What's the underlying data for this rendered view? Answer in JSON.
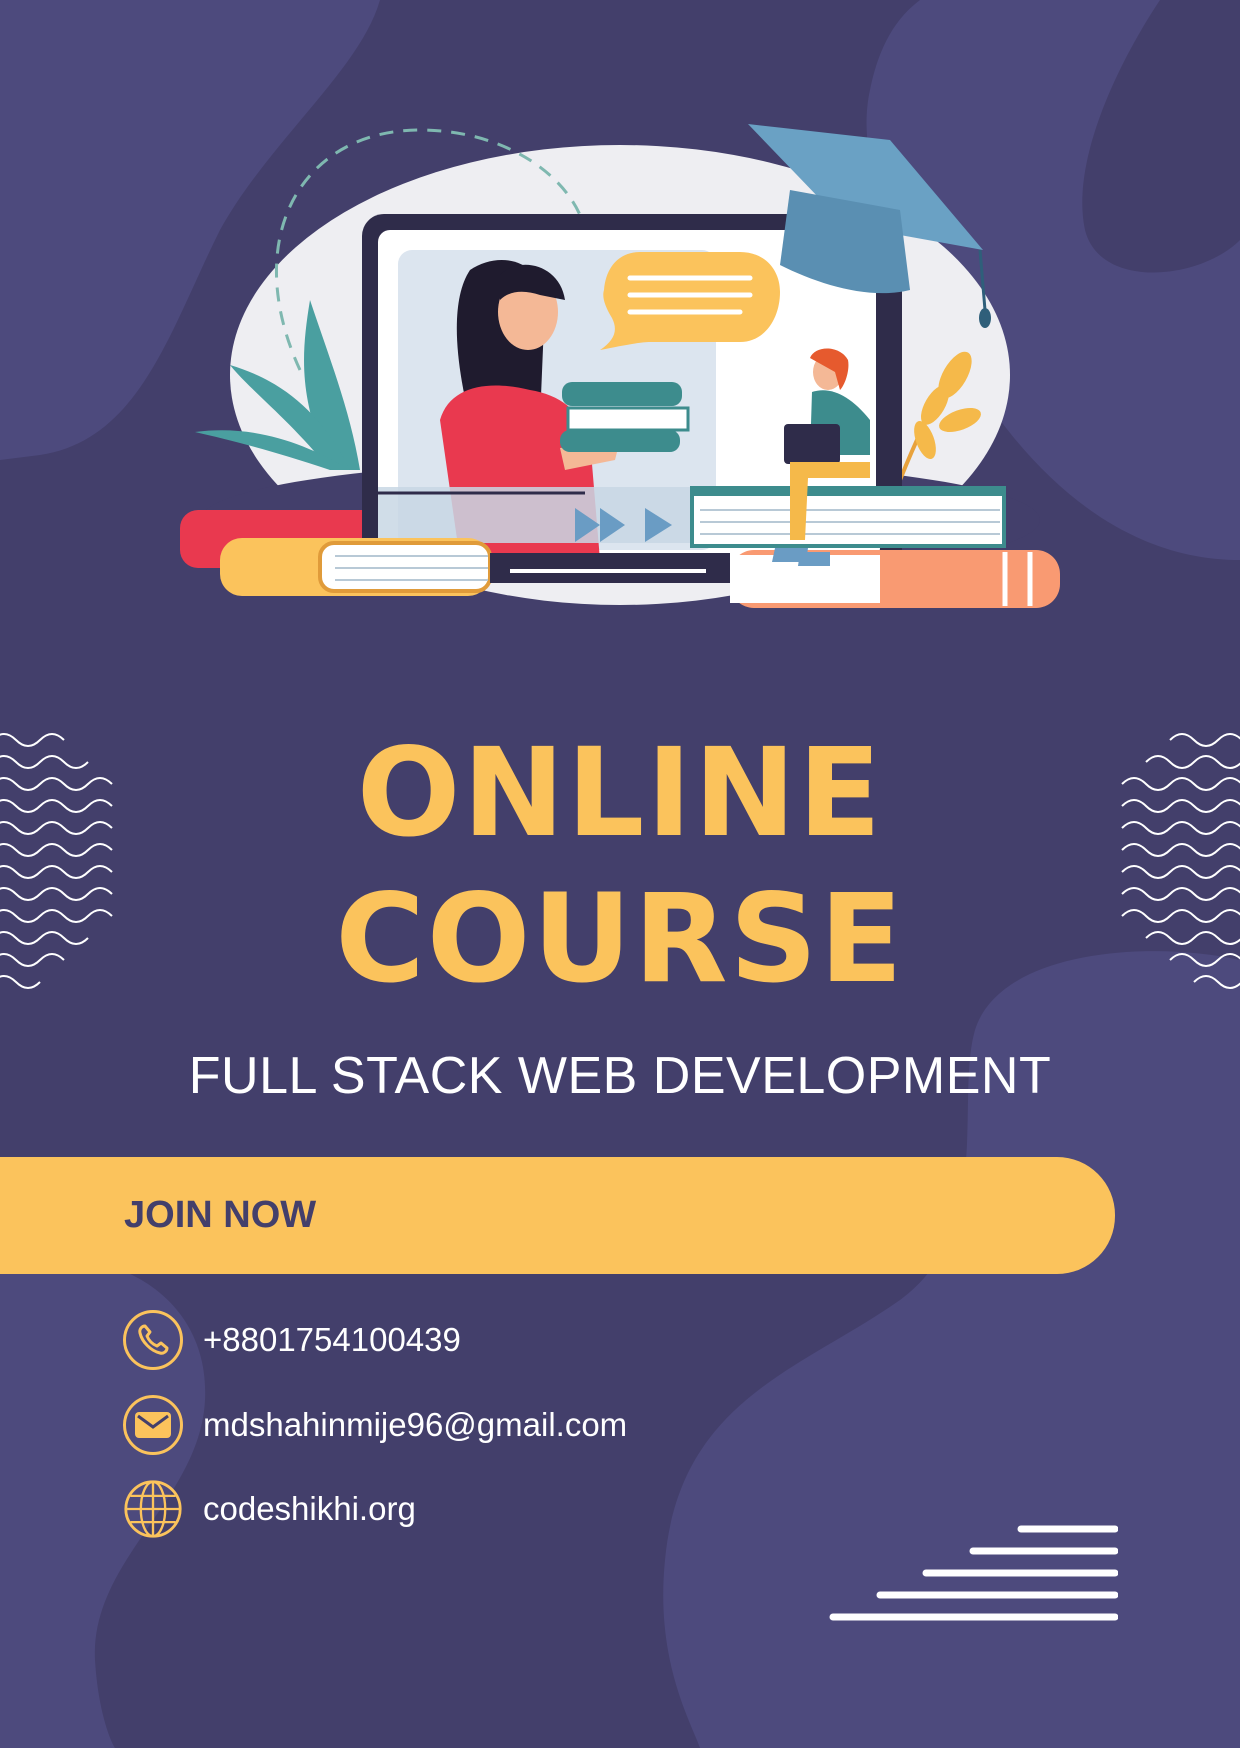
{
  "headline": {
    "line1": "ONLINE",
    "line2": "COURSE"
  },
  "subtitle": "FULL STACK WEB DEVELOPMENT",
  "cta": {
    "label": "JOIN NOW"
  },
  "contacts": [
    {
      "icon": "phone-icon",
      "text": "+8801754100439"
    },
    {
      "icon": "mail-icon",
      "text": "mdshahinmije96@gmail.com"
    },
    {
      "icon": "globe-icon",
      "text": "codeshikhi.org"
    }
  ],
  "colors": {
    "background": "#433f6b",
    "blob": "#4d4a7d",
    "accent_yellow": "#fbc35c",
    "text_white": "#ffffff"
  }
}
